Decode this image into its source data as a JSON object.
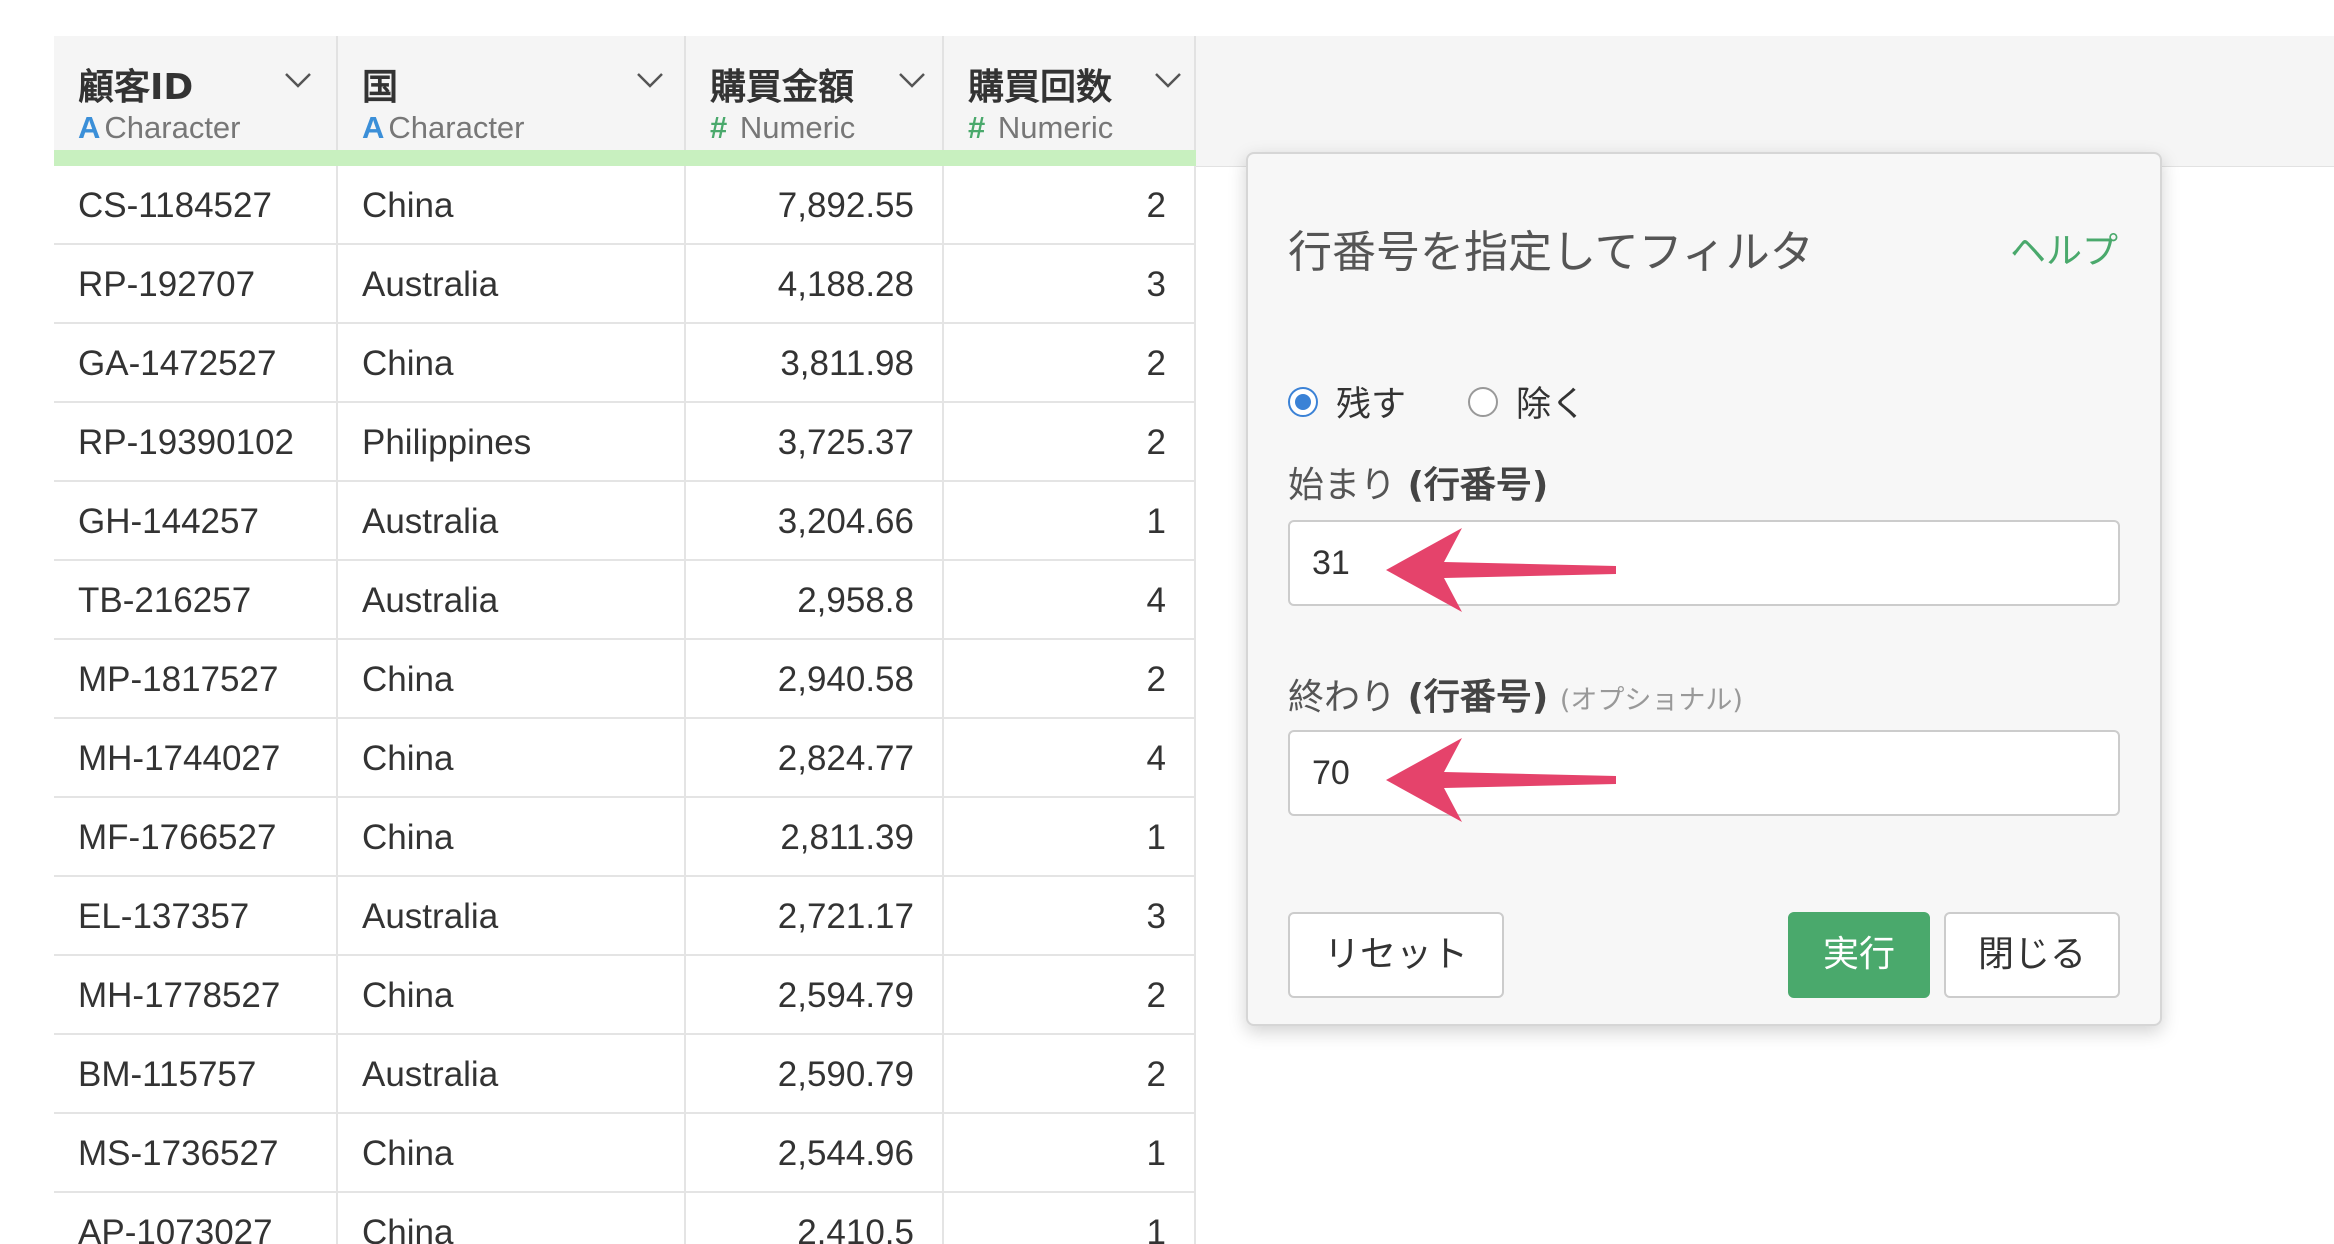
{
  "table": {
    "columns": [
      {
        "name": "顧客ID",
        "type_icon": "A",
        "type": "Character"
      },
      {
        "name": "国",
        "type_icon": "A",
        "type": "Character"
      },
      {
        "name": "購買金額",
        "type_icon": "#",
        "type": "Numeric"
      },
      {
        "name": "購買回数",
        "type_icon": "#",
        "type": "Numeric"
      }
    ],
    "rows": [
      {
        "id": "CS-1184527",
        "country": "China",
        "amount": "7,892.55",
        "count": "2"
      },
      {
        "id": "RP-192707",
        "country": "Australia",
        "amount": "4,188.28",
        "count": "3"
      },
      {
        "id": "GA-1472527",
        "country": "China",
        "amount": "3,811.98",
        "count": "2"
      },
      {
        "id": "RP-19390102",
        "country": "Philippines",
        "amount": "3,725.37",
        "count": "2"
      },
      {
        "id": "GH-144257",
        "country": "Australia",
        "amount": "3,204.66",
        "count": "1"
      },
      {
        "id": "TB-216257",
        "country": "Australia",
        "amount": "2,958.8",
        "count": "4"
      },
      {
        "id": "MP-1817527",
        "country": "China",
        "amount": "2,940.58",
        "count": "2"
      },
      {
        "id": "MH-1744027",
        "country": "China",
        "amount": "2,824.77",
        "count": "4"
      },
      {
        "id": "MF-1766527",
        "country": "China",
        "amount": "2,811.39",
        "count": "1"
      },
      {
        "id": "EL-137357",
        "country": "Australia",
        "amount": "2,721.17",
        "count": "3"
      },
      {
        "id": "MH-1778527",
        "country": "China",
        "amount": "2,594.79",
        "count": "2"
      },
      {
        "id": "BM-115757",
        "country": "Australia",
        "amount": "2,590.79",
        "count": "2"
      },
      {
        "id": "MS-1736527",
        "country": "China",
        "amount": "2,544.96",
        "count": "1"
      },
      {
        "id": "AP-1073027",
        "country": "China",
        "amount": "2,410.5",
        "count": "1"
      }
    ]
  },
  "dialog": {
    "title": "行番号を指定してフィルタ",
    "help": "ヘルプ",
    "radio_keep": "残す",
    "radio_exclude": "除く",
    "selected": "残す",
    "start_label": "始まり",
    "start_paren": "(行番号)",
    "start_value": "31",
    "end_label": "終わり",
    "end_paren": "(行番号)",
    "end_optional": "(オプショナル)",
    "end_value": "70",
    "reset_button": "リセット",
    "run_button": "実行",
    "close_button": "閉じる"
  },
  "colors": {
    "accent_green": "#4aa96c",
    "radio_blue": "#3b82d6",
    "arrow_pink": "#e5436b",
    "header_bar": "#c8f0bf"
  }
}
